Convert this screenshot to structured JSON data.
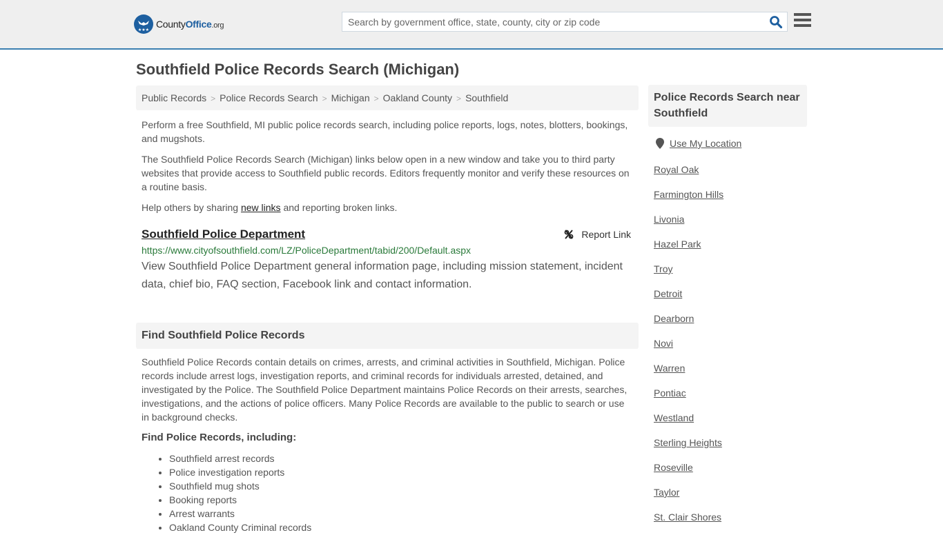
{
  "header": {
    "logo": {
      "county": "County",
      "office": "Office",
      "org": ".org"
    },
    "search_placeholder": "Search by government office, state, county, city or zip code",
    "search_value": ""
  },
  "page_title": "Southfield Police Records Search (Michigan)",
  "breadcrumb": [
    "Public Records",
    "Police Records Search",
    "Michigan",
    "Oakland County",
    "Southfield"
  ],
  "intro": {
    "p1": "Perform a free Southfield, MI public police records search, including police reports, logs, notes, blotters, bookings, and mugshots.",
    "p2": "The Southfield Police Records Search (Michigan) links below open in a new window and take you to third party websites that provide access to Southfield public records. Editors frequently monitor and verify these resources on a routine basis.",
    "p3_before": "Help others by sharing ",
    "p3_link": "new links",
    "p3_after": " and reporting broken links."
  },
  "result": {
    "title": "Southfield Police Department",
    "report_label": "Report Link",
    "url": "https://www.cityofsouthfield.com/LZ/PoliceDepartment/tabid/200/Default.aspx",
    "description": "View Southfield Police Department general information page, including mission statement, incident data, chief bio, FAQ section, Facebook link and contact information."
  },
  "find_section": {
    "heading": "Find Southfield Police Records",
    "body": "Southfield Police Records contain details on crimes, arrests, and criminal activities in Southfield, Michigan. Police records include arrest logs, investigation reports, and criminal records for individuals arrested, detained, and investigated by the Police. The Southfield Police Department maintains Police Records on their arrests, searches, investigations, and the actions of police officers. Many Police Records are available to the public to search or use in background checks.",
    "subheading": "Find Police Records, including:",
    "items": [
      "Southfield arrest records",
      "Police investigation reports",
      "Southfield mug shots",
      "Booking reports",
      "Arrest warrants",
      "Oakland County Criminal records"
    ]
  },
  "sidebar": {
    "heading": "Police Records Search near Southfield",
    "use_location": "Use My Location",
    "cities": [
      "Royal Oak",
      "Farmington Hills",
      "Livonia",
      "Hazel Park",
      "Troy",
      "Detroit",
      "Dearborn",
      "Novi",
      "Warren",
      "Pontiac",
      "Westland",
      "Sterling Heights",
      "Roseville",
      "Taylor",
      "St. Clair Shores"
    ]
  },
  "colors": {
    "brand": "#1d5fa0",
    "header_border": "#3b7fb0",
    "url_green": "#2a7a3a"
  }
}
